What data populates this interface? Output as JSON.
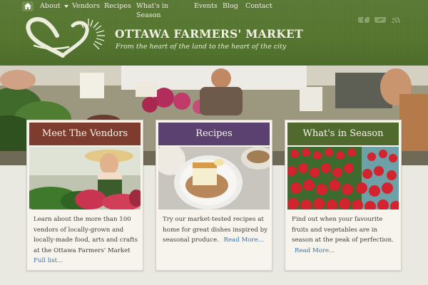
{
  "nav": {
    "home_icon": "home-icon",
    "items": [
      {
        "label": "About",
        "has_dropdown": true
      },
      {
        "label": "Vendors"
      },
      {
        "label": "Recipes"
      },
      {
        "label": "What's in",
        "label2": "Season"
      },
      {
        "label": "Events"
      },
      {
        "label": "Blog"
      },
      {
        "label": "Contact"
      }
    ],
    "dropdown_icon": "caret-down-icon"
  },
  "header": {
    "title": "OTTAWA FARMERS' MARKET",
    "tagline": "From the heart of the land to the heart of the city",
    "logo": "heart-sun-logo",
    "social_icons": [
      "facebook-icon",
      "twitter-icon",
      "rss-icon"
    ],
    "bg_color": "#56772f"
  },
  "cards": [
    {
      "title": "Meet The Vendors",
      "header_color": "#7e3c2e",
      "text": "Learn about the more than 100 vendors of locally-grown and locally-made food, arts and crafts at the Ottawa Farmers' Market",
      "link": "Full list..."
    },
    {
      "title": "Recipes",
      "header_color": "#5a4170",
      "text": "Try our market-tested recipes at home for great dishes inspired by seasonal produce.",
      "link": "Read More..."
    },
    {
      "title": "What's in Season",
      "header_color": "#4f6a2c",
      "text": "Find out when your favourite fruits and vegetables are in season at the peak of perfection.",
      "link": "Read More..."
    }
  ],
  "link_color": "#3a71a6"
}
